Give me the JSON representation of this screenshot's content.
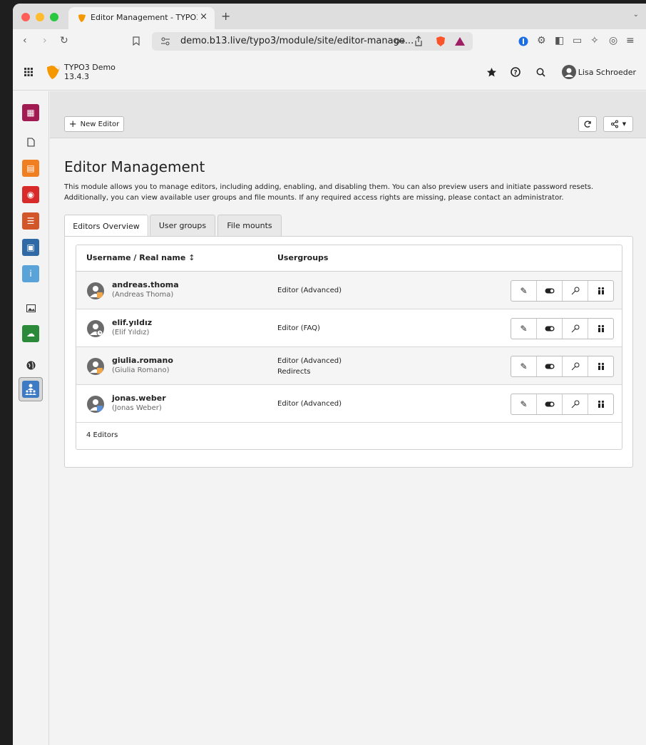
{
  "browser": {
    "tab_title": "Editor Management - TYPO3 Demo",
    "tab_close": "×",
    "new_tab": "+",
    "url": "demo.b13.live/typo3/module/site/editor-manage..."
  },
  "typo3": {
    "site_name": "TYPO3 Demo",
    "version": "13.4.3",
    "user": "Lisa Schroeder"
  },
  "docheader": {
    "new_editor_label": "New Editor"
  },
  "page": {
    "title": "Editor Management",
    "description": "This module allows you to manage editors, including adding, enabling, and disabling them. You can also preview users and initiate password resets. Additionally, you can view available user groups and file mounts. If any required access rights are missing, please contact an administrator."
  },
  "tabs": [
    "Editors Overview",
    "User groups",
    "File mounts"
  ],
  "table": {
    "col_username": "Username / Real name",
    "col_usergroups": "Usergroups",
    "rows": [
      {
        "username": "andreas.thoma",
        "realname": "(Andreas Thoma)",
        "groups": [
          "Editor (Advanced)"
        ]
      },
      {
        "username": "elif.yıldız",
        "realname": "(Elif Yıldız)",
        "groups": [
          "Editor (FAQ)"
        ]
      },
      {
        "username": "giulia.romano",
        "realname": "(Giulia Romano)",
        "groups": [
          "Editor (Advanced)",
          "Redirects"
        ]
      },
      {
        "username": "jonas.weber",
        "realname": "(Jonas Weber)",
        "groups": [
          "Editor (Advanced)"
        ]
      }
    ],
    "footer": "4 Editors"
  },
  "colors": {
    "typo3_orange": "#f49700",
    "active_module": "#3d7bc4"
  }
}
